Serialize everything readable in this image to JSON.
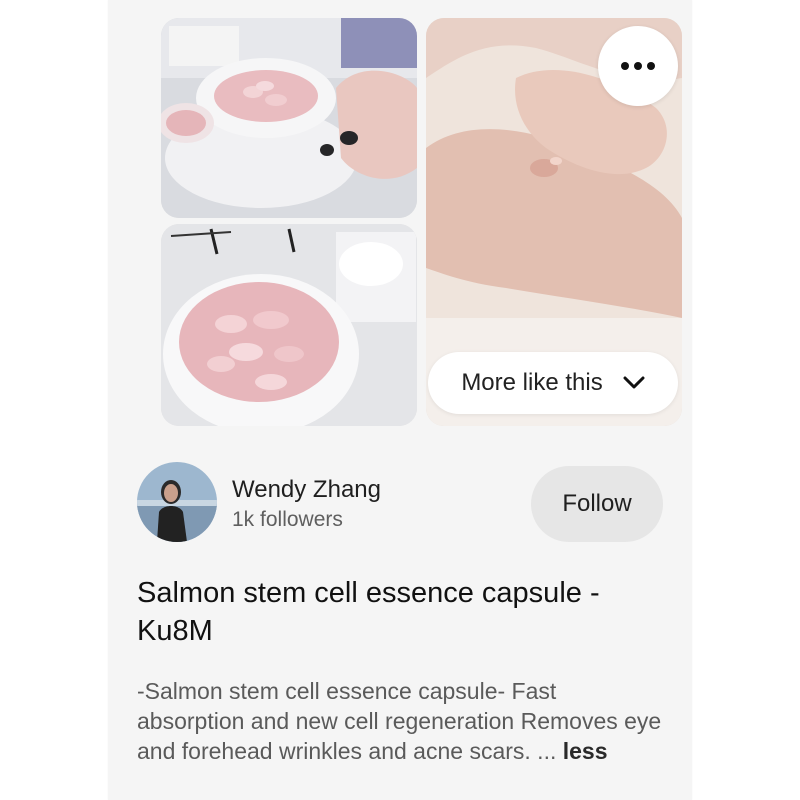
{
  "pin": {
    "more_like_this": "More like this",
    "options_icon": "more-horizontal-icon",
    "chevron_icon": "chevron-down-icon"
  },
  "creator": {
    "name": "Wendy Zhang",
    "followers": "1k followers",
    "follow_label": "Follow"
  },
  "title": "Salmon stem cell essence capsule - Ku8M",
  "description": {
    "text": "-Salmon stem cell essence capsule- Fast absorption and new cell regeneration Removes eye and forehead wrinkles and acne scars. ...",
    "toggle": "less"
  }
}
